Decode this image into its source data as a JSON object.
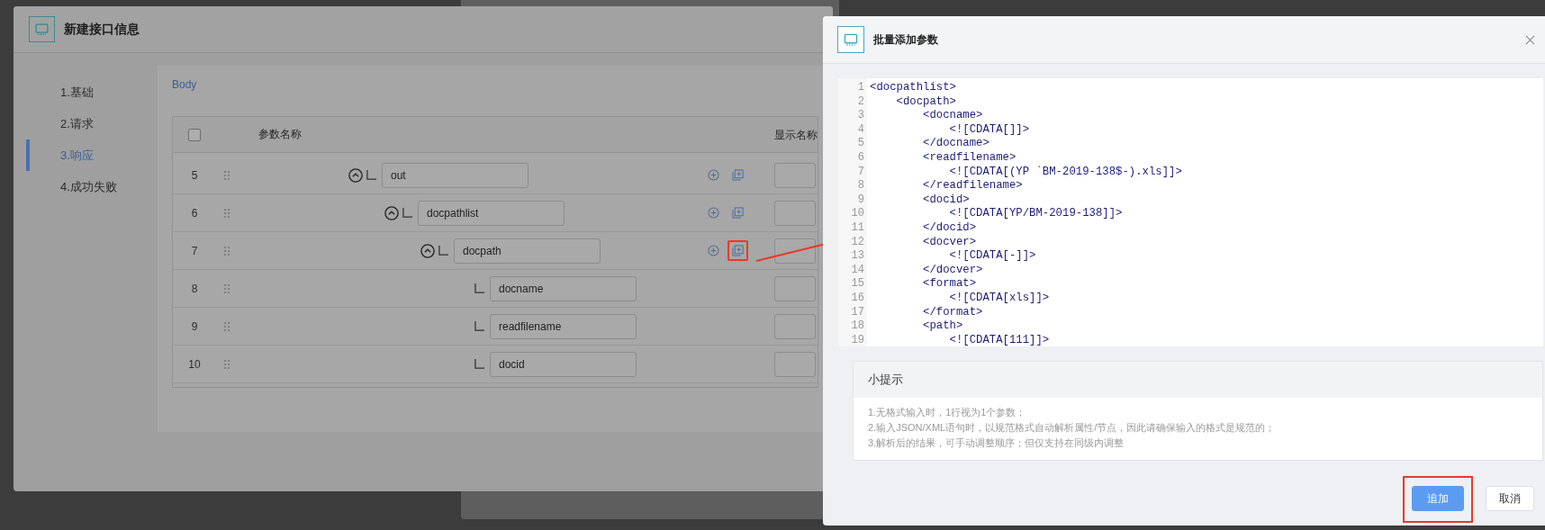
{
  "dialog": {
    "title": "新建接口信息",
    "steps": [
      {
        "label": "1.基础",
        "selected": false
      },
      {
        "label": "2.请求",
        "selected": false
      },
      {
        "label": "3.响应",
        "selected": true
      },
      {
        "label": "4.成功失败",
        "selected": false
      }
    ],
    "section_title": "Body",
    "table": {
      "select_all": {
        "checked": false
      },
      "columns": [
        "参数名称",
        "显示名称"
      ],
      "rows": [
        {
          "index": "5",
          "name": "out",
          "expanded": true,
          "annotated": false,
          "children": [
            {
              "index": "6",
              "name": "docpathlist",
              "expanded": true,
              "annotated": false,
              "children": [
                {
                  "index": "7",
                  "name": "docpath",
                  "expanded": true,
                  "annotated": true,
                  "children": [
                    {
                      "index": "8",
                      "name": "docname"
                    },
                    {
                      "index": "9",
                      "name": "readfilename"
                    },
                    {
                      "index": "10",
                      "name": "docid"
                    }
                  ]
                }
              ]
            }
          ]
        }
      ]
    }
  },
  "batch_panel": {
    "title": "批量添加参数",
    "code_lines": [
      {
        "number": "1",
        "text": "<docpathlist>"
      },
      {
        "number": "2",
        "text": "    <docpath>"
      },
      {
        "number": "3",
        "text": "        <docname>"
      },
      {
        "number": "4",
        "text": "            <![CDATA[]]>"
      },
      {
        "number": "5",
        "text": "        </docname>"
      },
      {
        "number": "6",
        "text": "        <readfilename>"
      },
      {
        "number": "7",
        "text": "            <![CDATA[(YP `BM-2019-138$-).xls]]>"
      },
      {
        "number": "8",
        "text": "        </readfilename>"
      },
      {
        "number": "9",
        "text": "        <docid>"
      },
      {
        "number": "10",
        "text": "            <![CDATA[YP/BM-2019-138]]>"
      },
      {
        "number": "11",
        "text": "        </docid>"
      },
      {
        "number": "12",
        "text": "        <docver>"
      },
      {
        "number": "13",
        "text": "            <![CDATA[-]]>"
      },
      {
        "number": "14",
        "text": "        </docver>"
      },
      {
        "number": "15",
        "text": "        <format>"
      },
      {
        "number": "16",
        "text": "            <![CDATA[xls]]>"
      },
      {
        "number": "17",
        "text": "        </format>"
      },
      {
        "number": "18",
        "text": "        <path>"
      },
      {
        "number": "19",
        "text": "            <![CDATA[111]]>"
      }
    ],
    "tips": {
      "title": "小提示",
      "items": [
        "1.无格式输入时，1行视为1个参数；",
        "2.输入JSON/XML语句时，以规范格式自动解析属性/节点，因此请确保输入的格式是规范的；",
        "3.解析后的结果，可手动调整顺序；但仅支持在同级内调整"
      ]
    },
    "buttons": [
      {
        "label": "追加",
        "kind": "primary",
        "annotated": true
      },
      {
        "label": "取消",
        "kind": "default",
        "annotated": false
      }
    ]
  }
}
